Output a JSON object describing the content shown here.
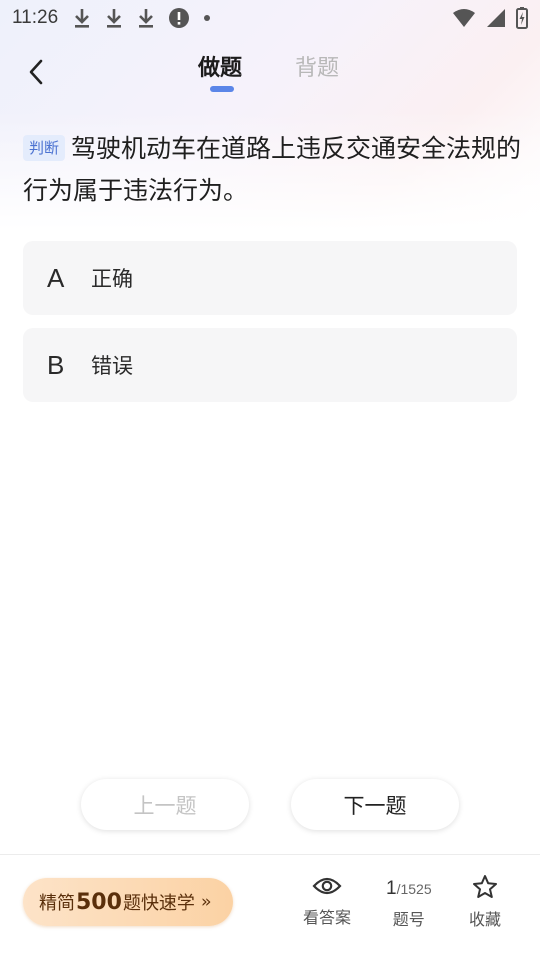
{
  "status_bar": {
    "time": "11:26"
  },
  "nav": {
    "tabs": [
      {
        "label": "做题",
        "active": true
      },
      {
        "label": "背题",
        "active": false
      }
    ],
    "accent_color": "#5b86e8"
  },
  "question": {
    "type_tag": "判断",
    "text": "驾驶机动车在道路上违反交通安全法规的行为属于违法行为。"
  },
  "options": [
    {
      "letter": "A",
      "text": "正确"
    },
    {
      "letter": "B",
      "text": "错误"
    }
  ],
  "pager": {
    "prev_label": "上一题",
    "next_label": "下一题"
  },
  "bottom_bar": {
    "promo": {
      "prefix": "精简",
      "number": "500",
      "suffix": "题",
      "tail": "快速学",
      "chevron": "››"
    },
    "answer_label": "看答案",
    "progress": {
      "current": "1",
      "total": "/1525",
      "label": "题号"
    },
    "favorite_label": "收藏"
  },
  "icons": {
    "back": "chevron-left-icon",
    "answer": "eye-icon",
    "favorite": "star-icon"
  }
}
